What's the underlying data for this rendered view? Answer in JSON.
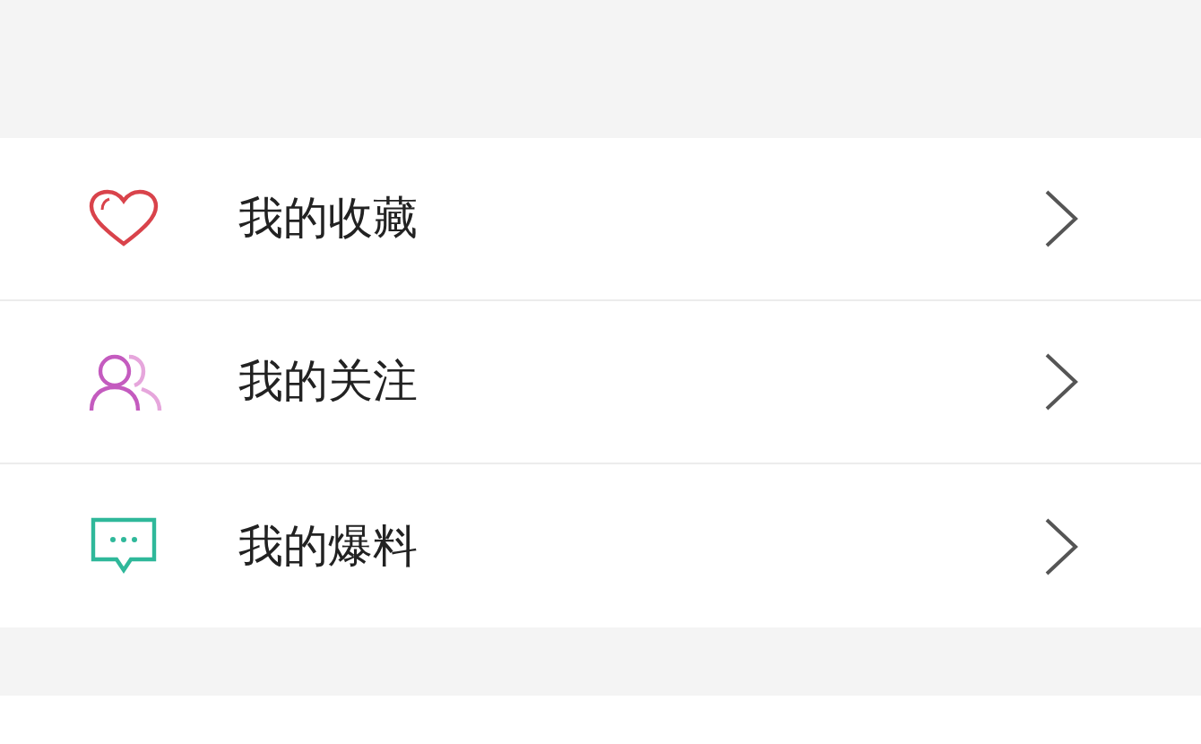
{
  "menu": [
    {
      "kind": "heart",
      "label": "我的收藏"
    },
    {
      "kind": "people",
      "label": "我的关注"
    },
    {
      "kind": "message",
      "label": "我的爆料"
    }
  ]
}
